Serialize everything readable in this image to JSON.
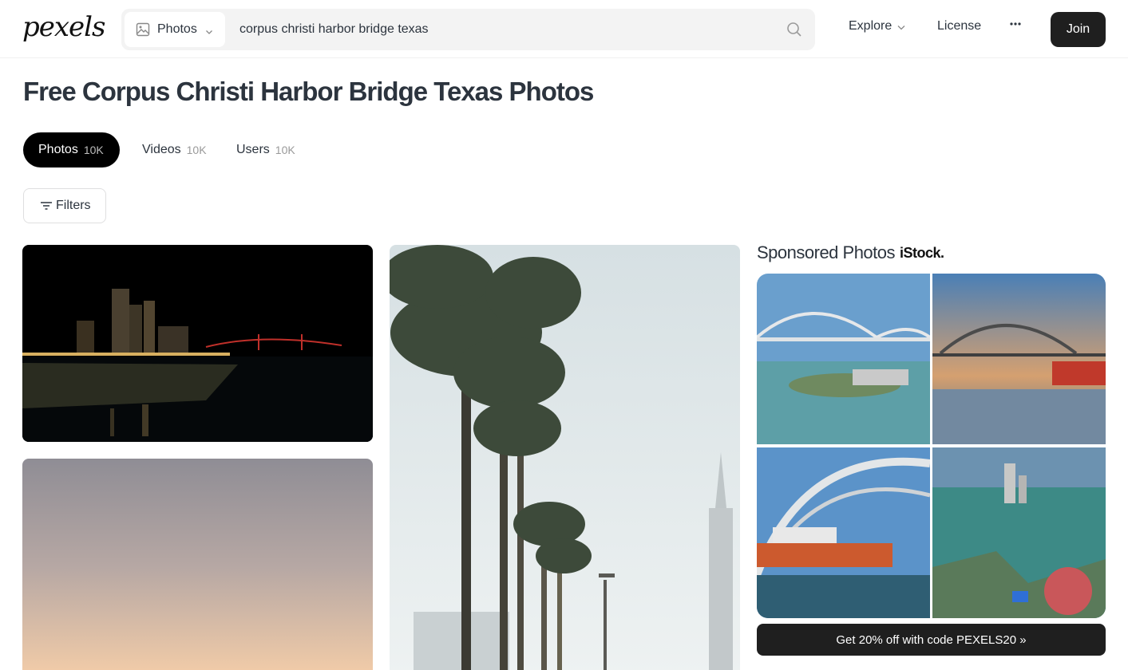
{
  "header": {
    "logo": "pexels",
    "search_type": "Photos",
    "search_query": "corpus christi harbor bridge texas",
    "nav": {
      "explore": "Explore",
      "license": "License",
      "more": "···"
    },
    "join_label": "Join"
  },
  "page_title": "Free Corpus Christi Harbor Bridge Texas Photos",
  "tabs": [
    {
      "label": "Photos",
      "count": "10K",
      "active": true
    },
    {
      "label": "Videos",
      "count": "10K",
      "active": false
    },
    {
      "label": "Users",
      "count": "10K",
      "active": false
    }
  ],
  "filters_label": "Filters",
  "photos": [
    {
      "description_icon": "night-bridge-photo"
    },
    {
      "description_icon": "sunset-sky-photo"
    },
    {
      "description_icon": "palm-trees-photo"
    }
  ],
  "sponsored": {
    "title": "Sponsored Photos",
    "brand": "iStock.",
    "promo_label": "Get 20% off with code PEXELS20 »"
  },
  "colors": {
    "dark_button": "#1f1f1f",
    "active_tab": "#000000",
    "search_bg": "#f3f3f3",
    "text": "#2c343e"
  }
}
